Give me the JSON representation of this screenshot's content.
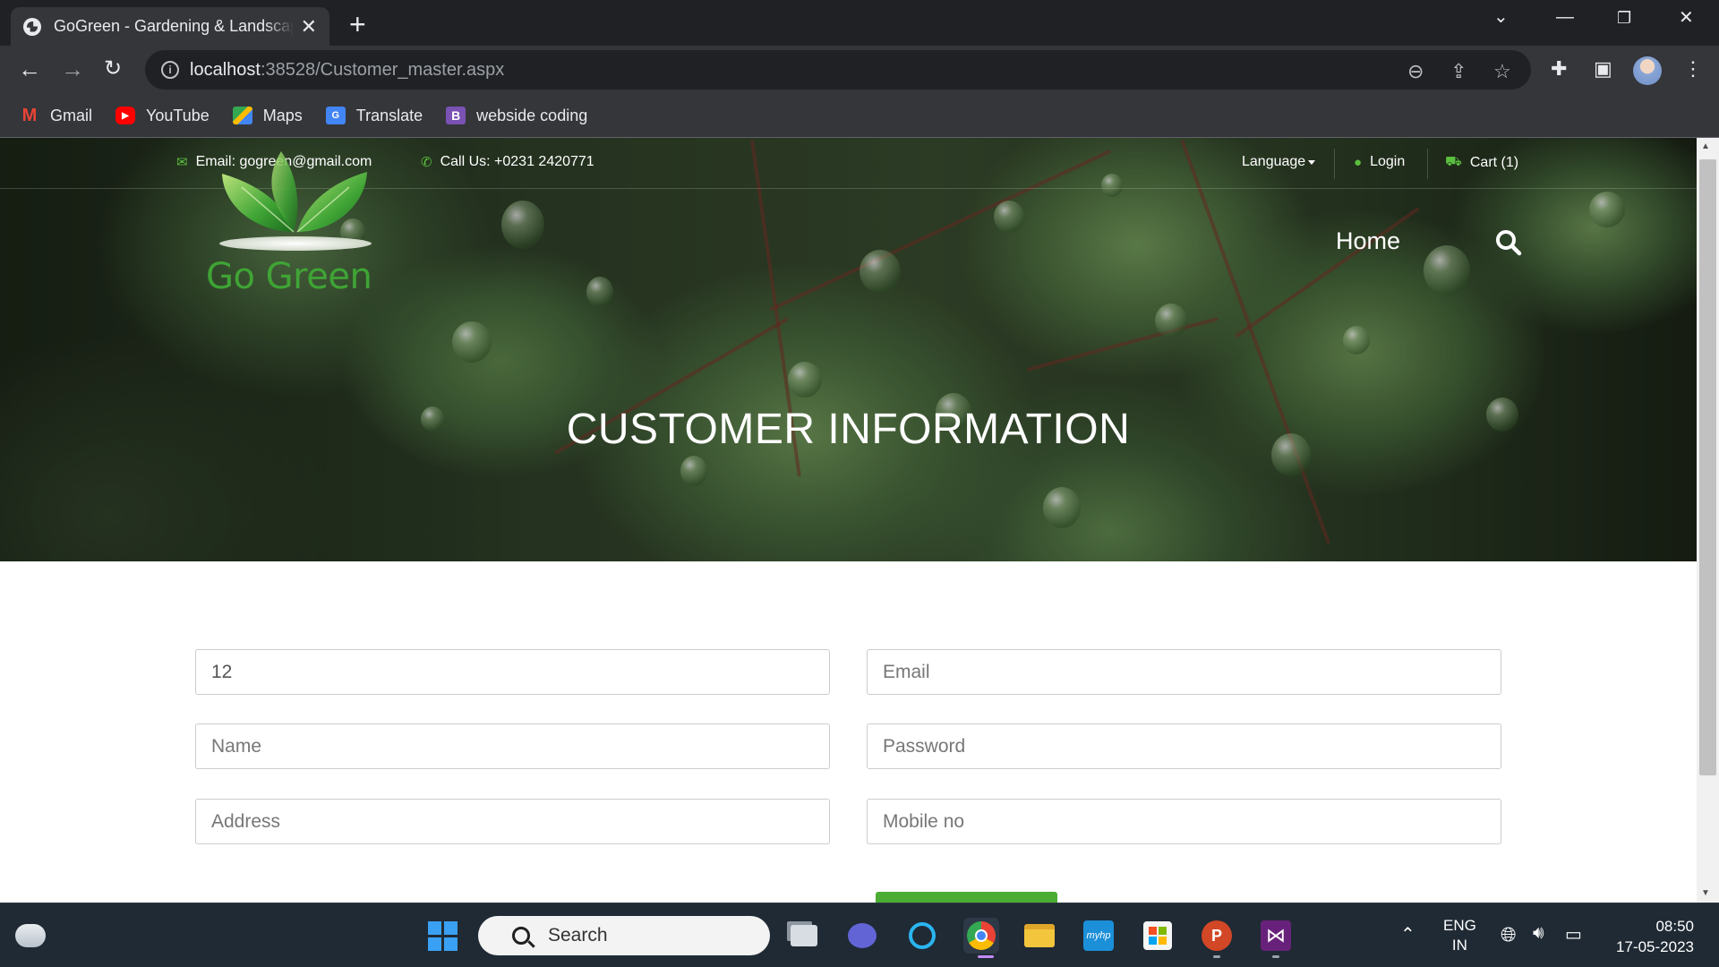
{
  "browser": {
    "tab_title": "GoGreen - Gardening & Landscaping",
    "url_host": "localhost",
    "url_path": ":38528/Customer_master.aspx",
    "bookmarks": [
      {
        "label": "Gmail",
        "icon": "gmail-icon",
        "color": "#ea4335"
      },
      {
        "label": "YouTube",
        "icon": "youtube-icon",
        "color": "#ff0000"
      },
      {
        "label": "Maps",
        "icon": "maps-icon",
        "color": "#34a853"
      },
      {
        "label": "Translate",
        "icon": "translate-icon",
        "color": "#4285f4"
      },
      {
        "label": "webside coding",
        "icon": "bootstrap-icon",
        "color": "#7952b3"
      }
    ]
  },
  "site": {
    "topbar": {
      "email": "Email: gogreen@gmail.com",
      "phone": "Call Us: +0231 2420771",
      "language": "Language",
      "login": "Login",
      "cart": "Cart (1)"
    },
    "logo_text": "Go Green",
    "nav": {
      "home": "Home"
    },
    "hero_title": "CUSTOMER INFORMATION",
    "accent_color": "#4cad34",
    "form": {
      "id_value": "12",
      "email_placeholder": "Email",
      "name_placeholder": "Name",
      "password_placeholder": "Password",
      "address_placeholder": "Address",
      "mobile_placeholder": "Mobile no"
    }
  },
  "taskbar": {
    "search_label": "Search",
    "lang_line1": "ENG",
    "lang_line2": "IN",
    "time": "08:50",
    "date": "17-05-2023"
  }
}
